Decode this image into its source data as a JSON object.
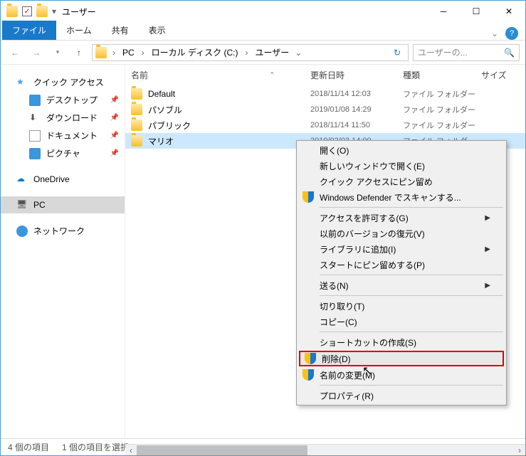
{
  "window": {
    "title": "ユーザー"
  },
  "ribbon": {
    "file": "ファイル",
    "home": "ホーム",
    "share": "共有",
    "view": "表示"
  },
  "breadcrumbs": [
    "PC",
    "ローカル ディスク (C:)",
    "ユーザー"
  ],
  "search": {
    "placeholder": "ユーザーの..."
  },
  "tree": {
    "quick": "クイック アクセス",
    "desktop": "デスクトップ",
    "downloads": "ダウンロード",
    "documents": "ドキュメント",
    "pictures": "ピクチャ",
    "onedrive": "OneDrive",
    "pc": "PC",
    "network": "ネットワーク"
  },
  "columns": {
    "name": "名前",
    "date": "更新日時",
    "type": "種類",
    "size": "サイズ"
  },
  "rows": [
    {
      "name": "Default",
      "date": "2018/11/14 12:03",
      "type": "ファイル フォルダー"
    },
    {
      "name": "パソブル",
      "date": "2019/01/08 14:29",
      "type": "ファイル フォルダー"
    },
    {
      "name": "パブリック",
      "date": "2018/11/14 11:50",
      "type": "ファイル フォルダー"
    },
    {
      "name": "マリオ",
      "date": "2019/02/03 14:00",
      "type": "ファイル フォルダー",
      "selected": true
    }
  ],
  "context": {
    "open": "開く(O)",
    "open_new": "新しいウィンドウで開く(E)",
    "pin_quick": "クイック アクセスにピン留め",
    "defender": "Windows Defender でスキャンする...",
    "grant_access": "アクセスを許可する(G)",
    "restore_ver": "以前のバージョンの復元(V)",
    "add_library": "ライブラリに追加(I)",
    "pin_start": "スタートにピン留めする(P)",
    "send_to": "送る(N)",
    "cut": "切り取り(T)",
    "copy": "コピー(C)",
    "shortcut": "ショートカットの作成(S)",
    "delete": "削除(D)",
    "rename": "名前の変更(M)",
    "properties": "プロパティ(R)"
  },
  "status": {
    "count": "4 個の項目",
    "selected": "1 個の項目を選択"
  }
}
